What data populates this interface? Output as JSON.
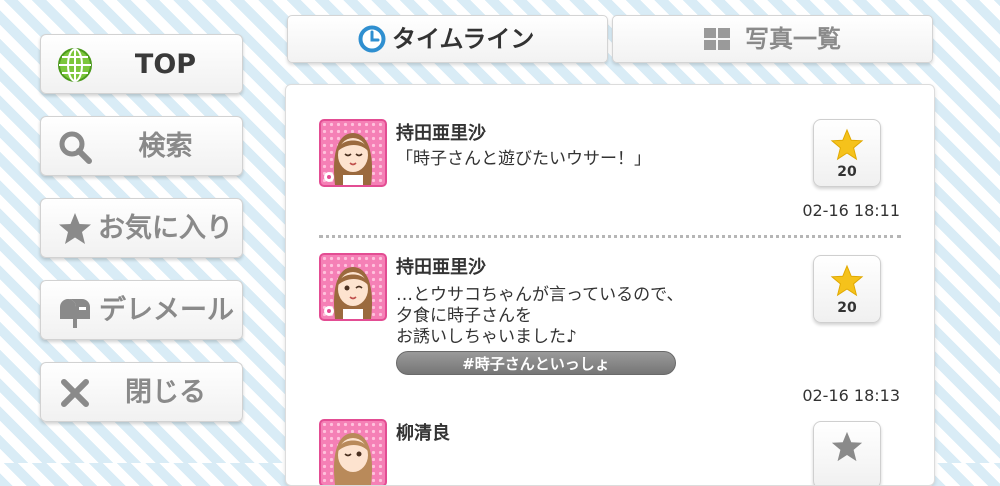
{
  "sidebar": {
    "top": "TOP",
    "search": "検索",
    "favorites": "お気に入り",
    "dere_mail": "デレメール",
    "close": "閉じる"
  },
  "tabs": {
    "timeline": "タイムライン",
    "photos": "写真一覧"
  },
  "posts": [
    {
      "name": "持田亜里沙",
      "message": "「時子さんと遊びたいウサー！」",
      "likes": "20",
      "time": "02-16 18:11"
    },
    {
      "name": "持田亜里沙",
      "message": "…とウサコちゃんが言っているので、\n夕食に時子さんを\nお誘いしちゃいました♪",
      "hashtag": "#時子さんといっしょ",
      "likes": "20",
      "time": "02-16 18:13"
    },
    {
      "name": "柳清良",
      "message": "",
      "likes": ""
    }
  ],
  "colors": {
    "accent_blue": "#2f8fd0",
    "star_gold": "#f5c21b",
    "avatar_pink": "#f580b6",
    "hashtag_gray": "#8a8a8a"
  }
}
